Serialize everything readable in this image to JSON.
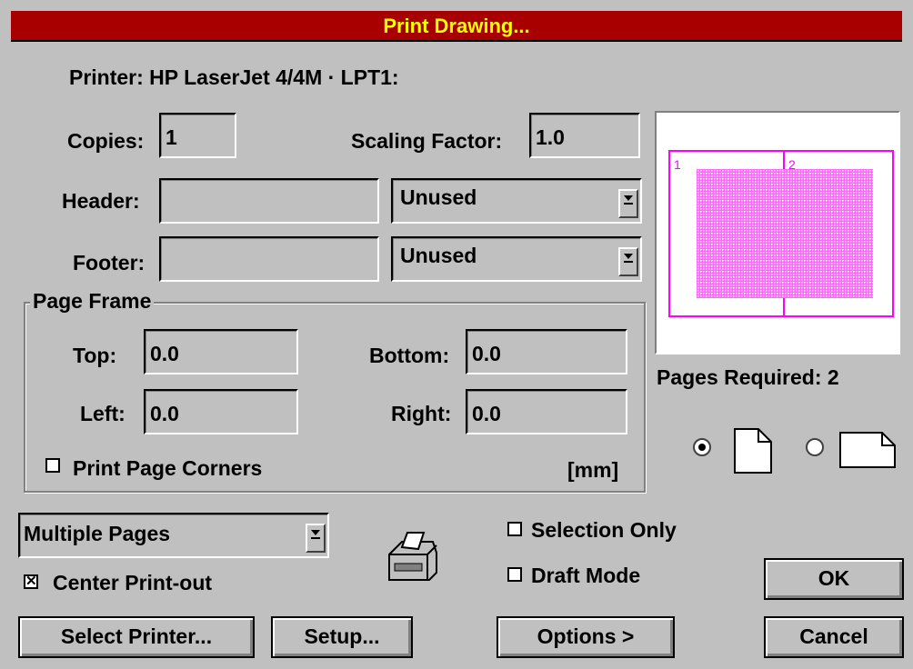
{
  "window": {
    "title": "Print Drawing..."
  },
  "printer": {
    "label": "Printer: HP LaserJet 4/4M · LPT1:"
  },
  "copies": {
    "label": "Copies:",
    "value": "1"
  },
  "scaling": {
    "label": "Scaling Factor:",
    "value": "1.0"
  },
  "header": {
    "label": "Header:",
    "value": "",
    "option": "Unused"
  },
  "footer": {
    "label": "Footer:",
    "value": "",
    "option": "Unused"
  },
  "page_frame": {
    "legend": "Page Frame",
    "top_label": "Top:",
    "top_value": "0.0",
    "bottom_label": "Bottom:",
    "bottom_value": "0.0",
    "left_label": "Left:",
    "left_value": "0.0",
    "right_label": "Right:",
    "right_value": "0.0",
    "corners_label": "Print Page Corners",
    "corners_checked": false,
    "unit": "[mm]"
  },
  "preview": {
    "page1_label": "1",
    "page2_label": "2",
    "pages_required": "Pages Required: 2",
    "accent_color": "#ff00ff",
    "orientation_selected": "portrait"
  },
  "mode": {
    "value": "Multiple Pages"
  },
  "center": {
    "label": "Center Print-out",
    "checked": true
  },
  "selection_only": {
    "label": "Selection Only",
    "checked": false
  },
  "draft_mode": {
    "label": "Draft Mode",
    "checked": false
  },
  "buttons": {
    "ok": "OK",
    "cancel": "Cancel",
    "select_printer": "Select Printer...",
    "setup": "Setup...",
    "options": "Options >"
  },
  "icons": {
    "dropdown": "dropdown-arrow-icon",
    "printer": "printer-icon",
    "portrait": "portrait-page-icon",
    "landscape": "landscape-page-icon"
  },
  "colors": {
    "title_bg": "#a80000",
    "title_text": "#ffff00",
    "face": "#c0c0c0"
  }
}
